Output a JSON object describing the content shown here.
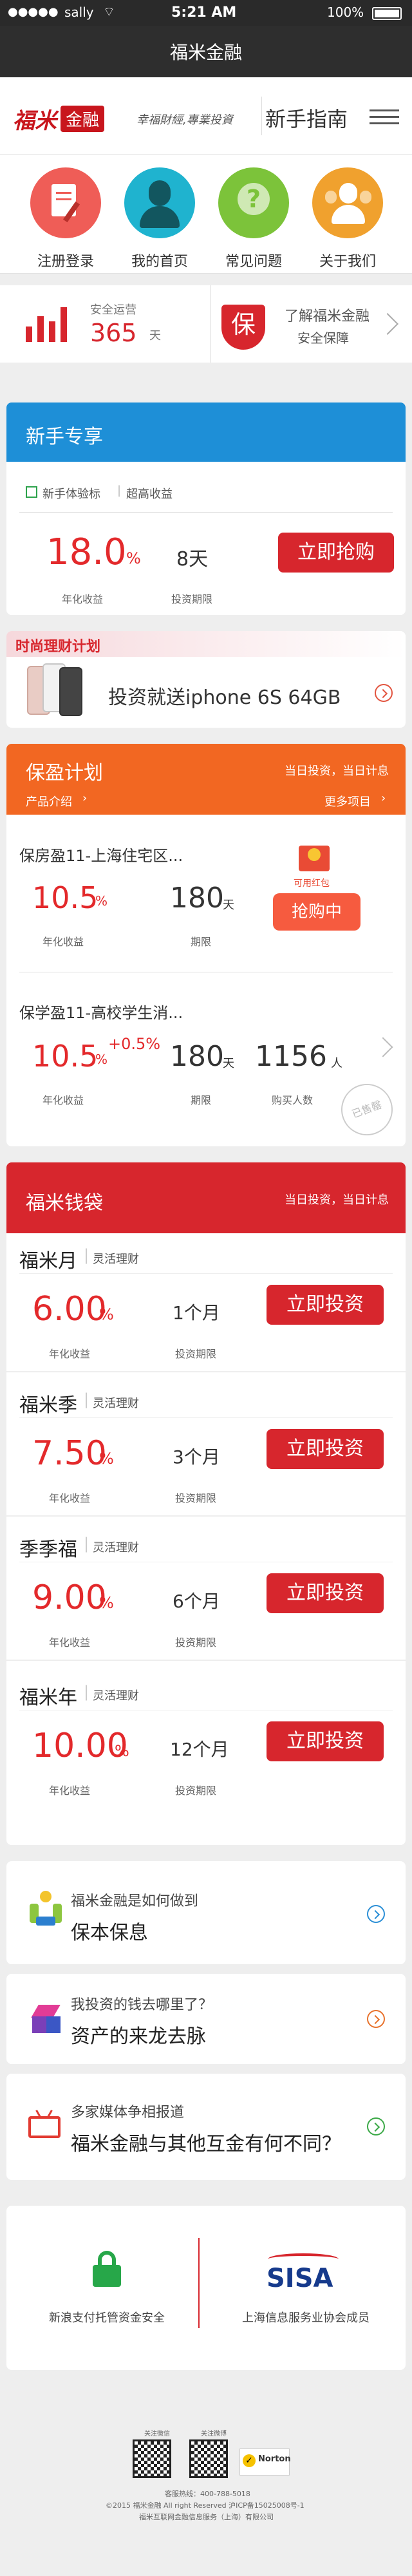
{
  "status_bar": {
    "carrier": "sally",
    "time": "5:21 AM",
    "battery": "100%"
  },
  "navbar": {
    "title": "福米金融"
  },
  "brand": {
    "logo_text": "福米",
    "logo_box": "金融",
    "slogan": "幸福財經,專業投資",
    "guide": "新手指南"
  },
  "quick_links": [
    {
      "label": "注册登录"
    },
    {
      "label": "我的首页"
    },
    {
      "label": "常见问题"
    },
    {
      "label": "关于我们"
    }
  ],
  "safety": {
    "days_label": "安全运营",
    "days": "365",
    "days_unit": "天",
    "shield": "保",
    "link_title": "了解福米金融",
    "link_sub": "安全保障"
  },
  "newbie": {
    "title": "新手专享",
    "tag": "新手体验标",
    "tag2": "超高收益",
    "rate": "18.0",
    "pct": "%",
    "rate_label": "年化收益",
    "term": "8天",
    "term_label": "投资期限",
    "button": "立即抢购"
  },
  "promo": {
    "banner": "时尚理财计划",
    "text": "投资就送iphone 6S  64GB"
  },
  "baoying": {
    "title": "保盈计划",
    "header_right": "当日投资，当日计息",
    "intro": "产品介绍",
    "more": "更多项目",
    "item1": {
      "name": "保房盈11-上海住宅区...",
      "rate": "10.5",
      "pct": "%",
      "rate_label": "年化收益",
      "term": "180",
      "term_unit": "天",
      "term_label": "期限",
      "badge": "可用红包",
      "button": "抢购中"
    },
    "item2": {
      "name": "保学盈11-高校学生消...",
      "rate": "10.5",
      "pct": "%",
      "bonus": "+0.5%",
      "rate_label": "年化收益",
      "term": "180",
      "term_unit": "天",
      "term_label": "期限",
      "buyers": "1156",
      "buyers_unit": "人",
      "buyers_label": "购买人数",
      "stamp": "已售罄"
    }
  },
  "wallet": {
    "title": "福米钱袋",
    "header_right": "当日投资，当日计息",
    "items": [
      {
        "name": "福米月",
        "tag": "灵活理财",
        "rate": "6.00",
        "pct": "%",
        "rate_label": "年化收益",
        "term": "1个月",
        "term_label": "投资期限",
        "button": "立即投资"
      },
      {
        "name": "福米季",
        "tag": "灵活理财",
        "rate": "7.50",
        "pct": "%",
        "rate_label": "年化收益",
        "term": "3个月",
        "term_label": "投资期限",
        "button": "立即投资"
      },
      {
        "name": "季季福",
        "tag": "灵活理财",
        "rate": "9.00",
        "pct": "%",
        "rate_label": "年化收益",
        "term": "6个月",
        "term_label": "投资期限",
        "button": "立即投资"
      },
      {
        "name": "福米年",
        "tag": "灵活理财",
        "rate": "10.00",
        "pct": "%",
        "rate_label": "年化收益",
        "term": "12个月",
        "term_label": "投资期限",
        "button": "立即投资"
      }
    ]
  },
  "info": [
    {
      "q": "福米金融是如何做到",
      "a": "保本保息",
      "color": "#2b8fd6"
    },
    {
      "q": "我投资的钱去哪里了？",
      "a": "资产的来龙去脉",
      "color": "#e8722c"
    },
    {
      "q": "多家媒体争相报道",
      "a": "福米金融与其他互金有何不同？",
      "color": "#39a845"
    }
  ],
  "partners": {
    "left": "新浪支付托管资金安全",
    "right_logo": "SISA",
    "right": "上海信息服务业协会成员"
  },
  "footer": {
    "qr1": "关注微信",
    "qr2": "关注微博",
    "norton": "Norton",
    "line1": "客服热线：400-788-5018",
    "line2": "©2015 福米金融 All right Reserved 沪ICP备15025008号-1",
    "line3": "福米互联网金融信息服务（上海）有限公司"
  }
}
